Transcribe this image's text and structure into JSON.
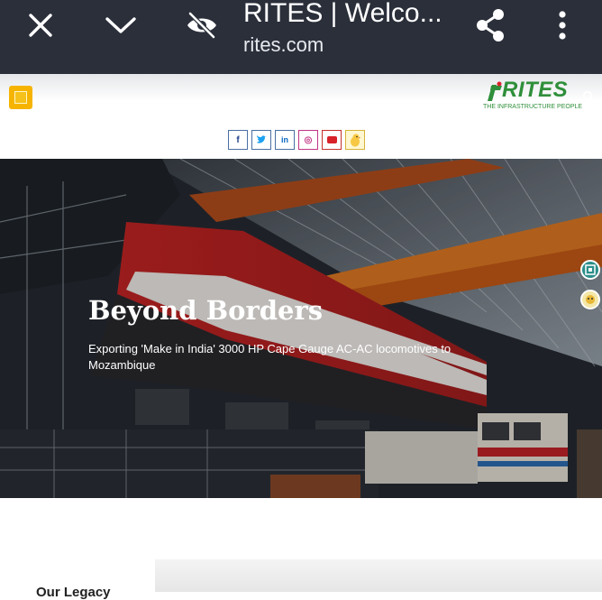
{
  "browser": {
    "title": "RITES | Welco...",
    "url": "rites.com",
    "icons": [
      "close-icon",
      "chevron-down-icon",
      "eye-off-icon",
      "share-icon",
      "more-vert-icon"
    ]
  },
  "header": {
    "logo_text": "RITES",
    "logo_tagline": "THE INFRASTRUCTURE PEOPLE",
    "brand_color": "#2f8f3a",
    "menu_color": "#f6b400"
  },
  "social": {
    "facebook": "f",
    "twitter": "t",
    "linkedin": "in",
    "instagram": "◎"
  },
  "hero": {
    "title": "Beyond Borders",
    "subtitle": "Exporting 'Make in India' 3000 HP Cape Gauge AC-AC locomotives to Mozambique"
  },
  "below": {
    "cut_text": "Our Legacy"
  }
}
